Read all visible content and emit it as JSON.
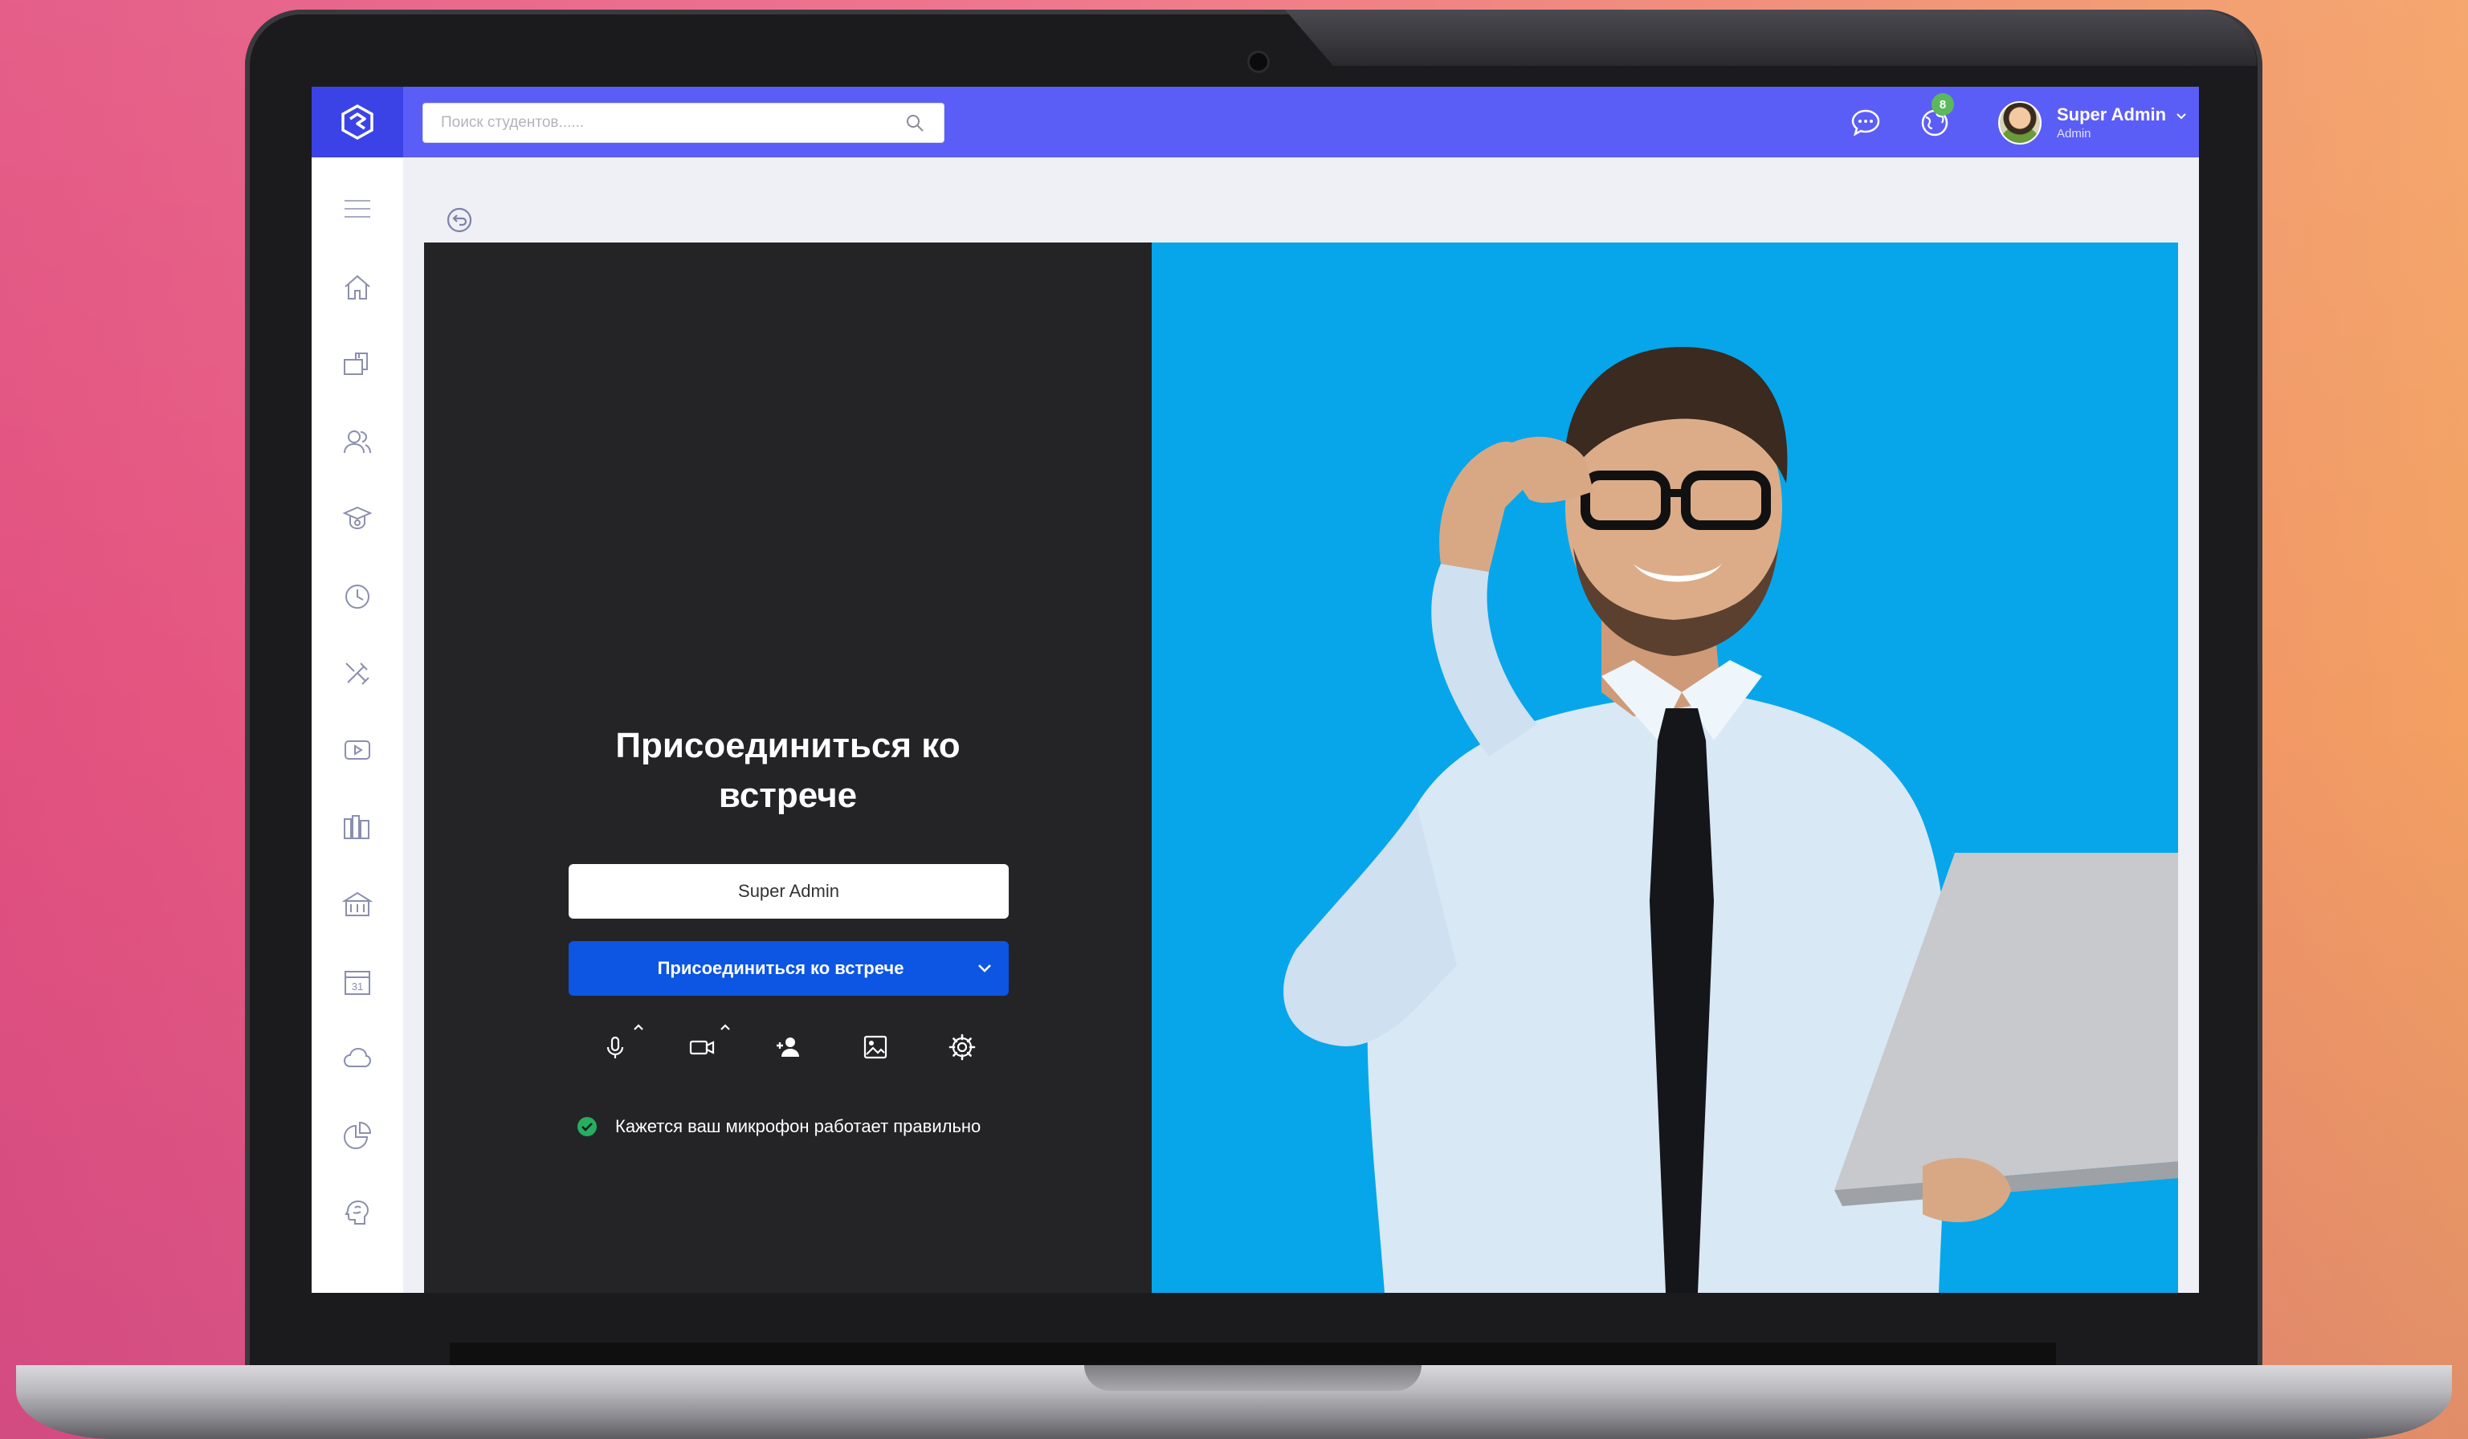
{
  "search": {
    "placeholder": "Поиск студентов......"
  },
  "header": {
    "notification_count": "8",
    "user_name": "Super Admin",
    "user_role": "Admin"
  },
  "sidebar": {
    "items": [
      {
        "icon": "menu-icon"
      },
      {
        "icon": "home-icon"
      },
      {
        "icon": "mailbox-icon"
      },
      {
        "icon": "users-icon"
      },
      {
        "icon": "graduation-icon"
      },
      {
        "icon": "clock-icon"
      },
      {
        "icon": "tools-icon"
      },
      {
        "icon": "video-icon"
      },
      {
        "icon": "library-icon"
      },
      {
        "icon": "building-icon"
      },
      {
        "icon": "calendar-icon"
      },
      {
        "icon": "cloud-icon"
      },
      {
        "icon": "report-icon"
      },
      {
        "icon": "brain-icon"
      }
    ]
  },
  "meeting": {
    "title_line1": "Присоединиться ко",
    "title_line2": "встрече",
    "name_value": "Super Admin",
    "join_button": "Присоединиться ко встрече",
    "mic_status": "Кажется ваш микрофон работает правильно",
    "status_color": "#27ae60",
    "button_color": "#0d55e3",
    "right_bg": "#07a6ea"
  },
  "colors": {
    "topbar": "#5b5ef6",
    "logo_bg": "#3b43e6"
  }
}
